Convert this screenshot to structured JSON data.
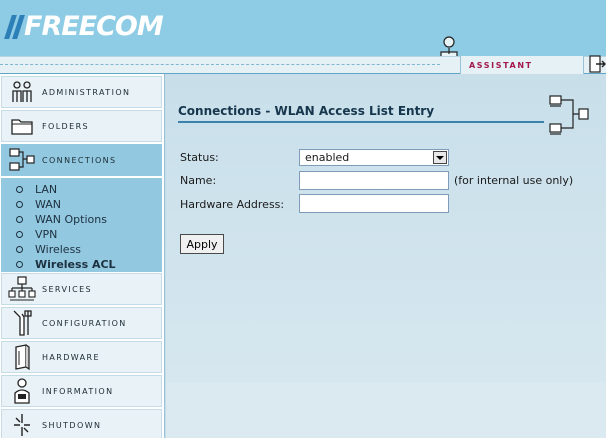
{
  "brand": {
    "logo_text": "FREECOM"
  },
  "assistant": {
    "label": "ASSISTANT"
  },
  "sidebar": {
    "items": [
      {
        "label": "ADMINISTRATION",
        "icon": "admin-users-icon"
      },
      {
        "label": "FOLDERS",
        "icon": "folder-icon"
      },
      {
        "label": "CONNECTIONS",
        "icon": "network-icon"
      },
      {
        "label": "SERVICES",
        "icon": "services-icon"
      },
      {
        "label": "CONFIGURATION",
        "icon": "tools-icon"
      },
      {
        "label": "HARDWARE",
        "icon": "hardware-icon"
      },
      {
        "label": "INFORMATION",
        "icon": "info-person-icon"
      },
      {
        "label": "SHUTDOWN",
        "icon": "power-icon"
      }
    ],
    "subitems": [
      "LAN",
      "WAN",
      "WAN Options",
      "VPN",
      "Wireless",
      "Wireless ACL"
    ]
  },
  "main": {
    "title": "Connections - WLAN Access List Entry",
    "form": {
      "status_label": "Status:",
      "status_value": "enabled",
      "name_label": "Name:",
      "name_value": "",
      "name_hint": "(for internal use only)",
      "hw_label": "Hardware Address:",
      "hw_value": "",
      "apply_label": "Apply"
    }
  },
  "colors": {
    "header": "#8ecbe4",
    "accent": "#a3184a",
    "active_nav": "#93c9e0"
  }
}
